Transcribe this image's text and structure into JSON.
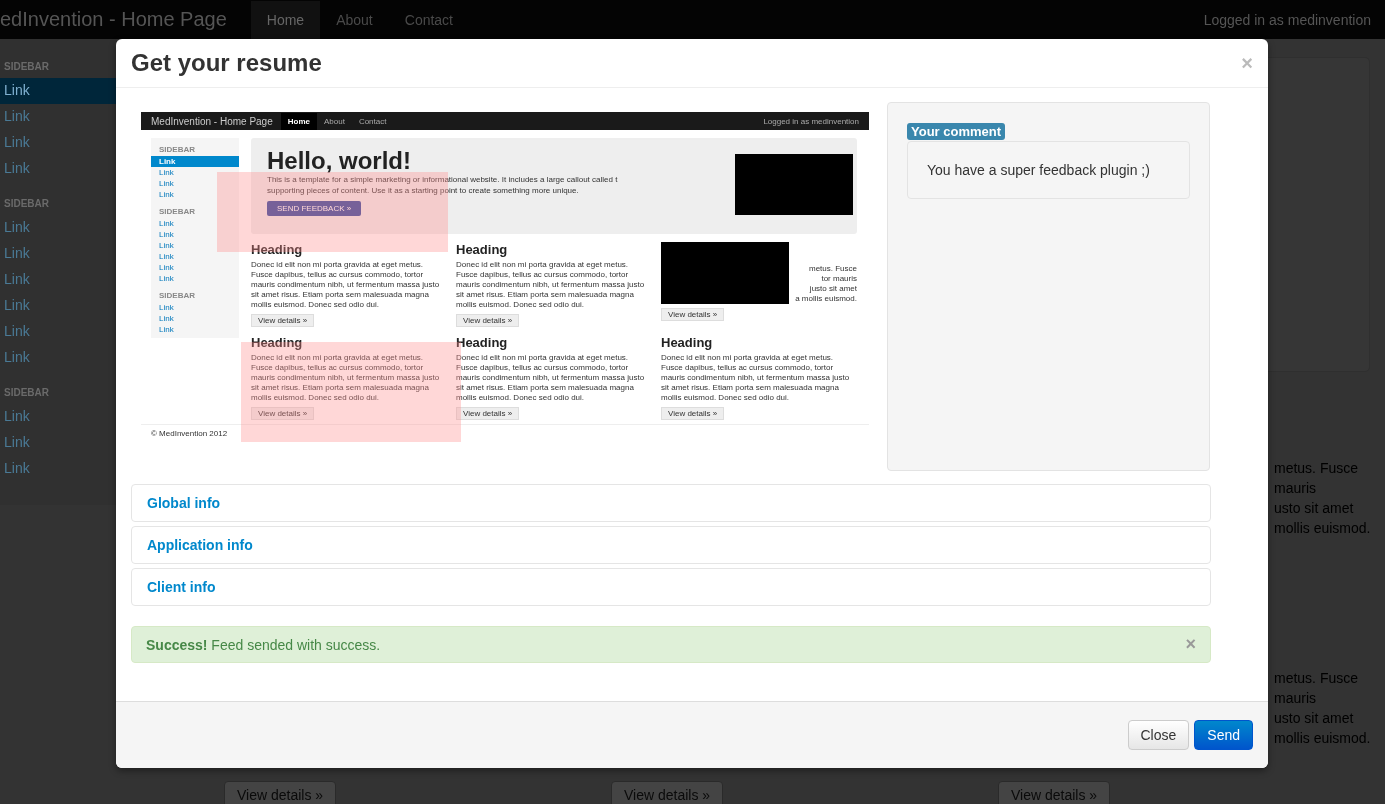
{
  "page": {
    "brand": "edInvention - Home Page",
    "nav": [
      {
        "label": "Home",
        "selected": true
      },
      {
        "label": "About",
        "selected": false
      },
      {
        "label": "Contact",
        "selected": false
      }
    ],
    "user": "Logged in as medinvention",
    "sidebar": [
      {
        "header": "SIDEBAR",
        "links": [
          {
            "label": "Link",
            "selected": true
          },
          {
            "label": "Link",
            "selected": false
          },
          {
            "label": "Link",
            "selected": false
          },
          {
            "label": "Link",
            "selected": false
          }
        ]
      },
      {
        "header": "SIDEBAR",
        "links": [
          {
            "label": "Link",
            "selected": false
          },
          {
            "label": "Link",
            "selected": false
          },
          {
            "label": "Link",
            "selected": false
          },
          {
            "label": "Link",
            "selected": false
          },
          {
            "label": "Link",
            "selected": false
          },
          {
            "label": "Link",
            "selected": false
          }
        ]
      },
      {
        "header": "SIDEBAR",
        "links": [
          {
            "label": "Link",
            "selected": false
          },
          {
            "label": "Link",
            "selected": false
          },
          {
            "label": "Link",
            "selected": false
          }
        ]
      }
    ],
    "fragments": [
      [
        "metus. Fusce",
        "mauris",
        "usto sit amet",
        "mollis euismod."
      ],
      [
        "metus. Fusce",
        "mauris",
        "usto sit amet",
        "mollis euismod."
      ]
    ],
    "buttons": [
      "View details »",
      "View details »",
      "View details »"
    ]
  },
  "modal": {
    "title": "Get your resume",
    "close": "×",
    "screenshot": {
      "brand": "MedInvention - Home Page",
      "nav": [
        {
          "label": "Home",
          "selected": true
        },
        {
          "label": "About",
          "selected": false
        },
        {
          "label": "Contact",
          "selected": false
        }
      ],
      "user": "Logged in as medinvention",
      "sidebar": [
        {
          "header": "SIDEBAR",
          "links": [
            {
              "label": "Link",
              "selected": true
            },
            {
              "label": "Link",
              "selected": false
            },
            {
              "label": "Link",
              "selected": false
            },
            {
              "label": "Link",
              "selected": false
            }
          ]
        },
        {
          "header": "SIDEBAR",
          "links": [
            {
              "label": "Link",
              "selected": false
            },
            {
              "label": "Link",
              "selected": false
            },
            {
              "label": "Link",
              "selected": false
            },
            {
              "label": "Link",
              "selected": false
            },
            {
              "label": "Link",
              "selected": false
            },
            {
              "label": "Link",
              "selected": false
            }
          ]
        },
        {
          "header": "SIDEBAR",
          "links": [
            {
              "label": "Link",
              "selected": false
            },
            {
              "label": "Link",
              "selected": false
            },
            {
              "label": "Link",
              "selected": false
            }
          ]
        }
      ],
      "hero": {
        "title": "Hello, world!",
        "lines": [
          "This is a template for a simple marketing or informational website. It includes a large callout called t",
          "supporting pieces of content. Use it as a starting point to create something more unique."
        ],
        "button": "SEND FEEDBACK »"
      },
      "cards": [
        {
          "heading": "Heading",
          "text": "Donec id elit non mi porta gravida at eget metus. Fusce dapibus, tellus ac cursus commodo, tortor mauris condimentum nibh, ut fermentum massa justo sit amet risus. Etiam porta sem malesuada magna mollis euismod. Donec sed odio dui.",
          "button": "View details »"
        },
        {
          "heading": "Heading",
          "text": "Donec id elit non mi porta gravida at eget metus. Fusce dapibus, tellus ac cursus commodo, tortor mauris condimentum nibh, ut fermentum massa justo sit amet risus. Etiam porta sem malesuada magna mollis euismod. Donec sed odio dui.",
          "button": "View details »"
        },
        {
          "lines": [
            "metus. Fusce",
            "tor mauris",
            "justo sit amet",
            "a mollis euismod."
          ],
          "button": "View details »"
        },
        {
          "heading": "Heading",
          "text": "Donec id elit non mi porta gravida at eget metus. Fusce dapibus, tellus ac cursus commodo, tortor mauris condimentum nibh, ut fermentum massa justo sit amet risus. Etiam porta sem malesuada magna mollis euismod. Donec sed odio dui.",
          "button": "View details »"
        },
        {
          "heading": "Heading",
          "text": "Donec id elit non mi porta gravida at eget metus. Fusce dapibus, tellus ac cursus commodo, tortor mauris condimentum nibh, ut fermentum massa justo sit amet risus. Etiam porta sem malesuada magna mollis euismod. Donec sed odio dui.",
          "button": "View details »"
        },
        {
          "heading": "Heading",
          "text": "Donec id elit non mi porta gravida at eget metus. Fusce dapibus, tellus ac cursus commodo, tortor mauris condimentum nibh, ut fermentum massa justo sit amet risus. Etiam porta sem malesuada magna mollis euismod. Donec sed odio dui.",
          "button": "View details »"
        }
      ],
      "footer": "© MedInvention 2012"
    },
    "comment": {
      "label": "Your comment",
      "text": "You have a super feedback plugin ;)"
    },
    "sections": [
      "Global info",
      "Application info",
      "Client info"
    ],
    "alert": {
      "text": "**Success!** Feed sended with success.",
      "close": "×"
    },
    "buttons": [
      {
        "label": "Close",
        "kind": "default"
      },
      {
        "label": "Send",
        "kind": "primary"
      }
    ]
  }
}
